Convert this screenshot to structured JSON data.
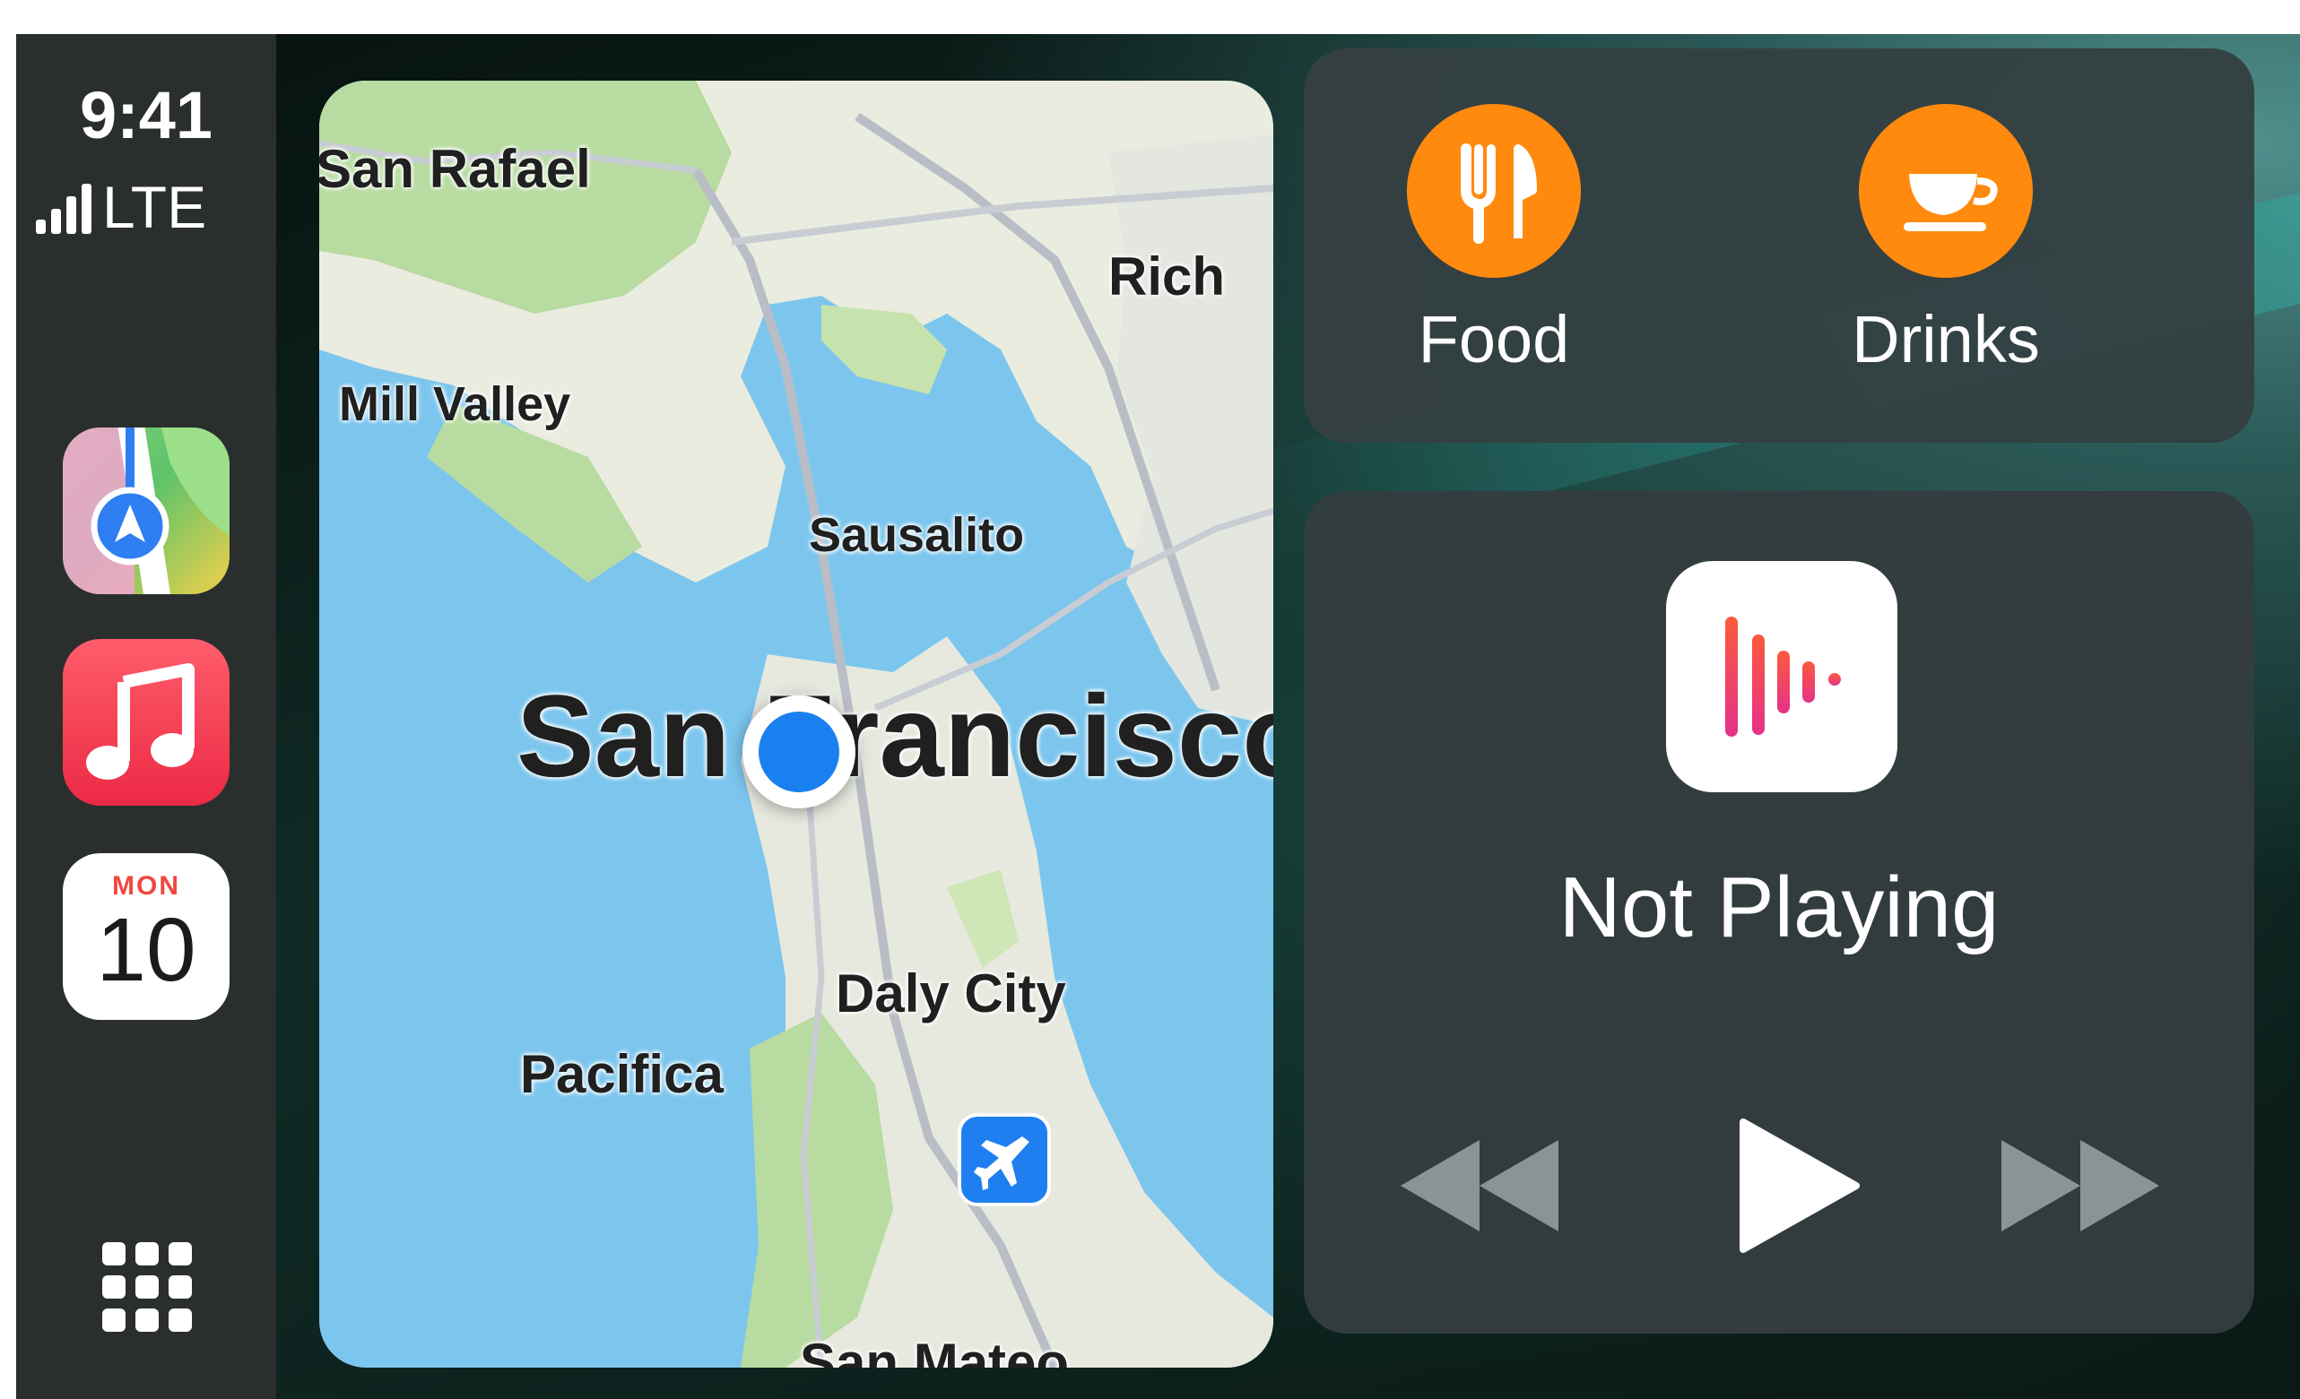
{
  "status_bar": {
    "time": "9:41",
    "network": "LTE",
    "signal_bars": 4
  },
  "dock": {
    "apps": [
      {
        "name": "Maps",
        "icon": "maps-app-icon"
      },
      {
        "name": "Music",
        "icon": "music-app-icon"
      },
      {
        "name": "Calendar",
        "icon": "calendar-app-icon",
        "day": "MON",
        "date": "10"
      }
    ],
    "grid_icon": "app-grid-icon"
  },
  "map": {
    "labels": [
      "San Rafael",
      "Rich",
      "Mill Valley",
      "Sausalito",
      "San Francisco",
      "Daly City",
      "Pacifica",
      "San Mateo"
    ],
    "airport_icon": "airplane-icon",
    "location_icon": "current-location-dot"
  },
  "poi": {
    "food": {
      "label": "Food",
      "icon": "fork-knife-icon"
    },
    "drinks": {
      "label": "Drinks",
      "icon": "coffee-cup-icon"
    },
    "accent": "#ff8a0e"
  },
  "now_playing": {
    "title": "Not Playing",
    "icon": "podcasts-icon",
    "controls": [
      "rewind-icon",
      "play-icon",
      "fast-forward-icon"
    ]
  },
  "colors": {
    "dock_bg": "#2a2f2d",
    "card_bg": "#343f42",
    "water": "#7cc6ee",
    "location_blue": "#1a80f0"
  }
}
